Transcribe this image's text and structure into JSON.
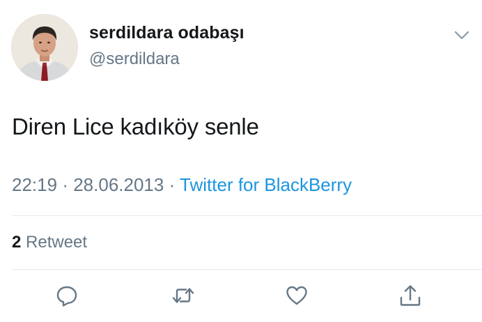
{
  "tweet": {
    "display_name": "serdildara odabaşı",
    "handle": "@serdildara",
    "text": "Diren Lice kadıköy senle",
    "time": "22:19",
    "separator": "·",
    "date": "28.06.2013",
    "source": "Twitter for BlackBerry"
  },
  "stats": {
    "retweet_count": "2",
    "retweet_label": "Retweet"
  },
  "actions": [
    {
      "icon": "reply-icon"
    },
    {
      "icon": "retweet-icon"
    },
    {
      "icon": "like-icon"
    },
    {
      "icon": "share-icon"
    }
  ],
  "colors": {
    "primary_text": "#14171a",
    "secondary_text": "#657786",
    "link": "#1b95e0",
    "divider": "#e1e8ed"
  }
}
